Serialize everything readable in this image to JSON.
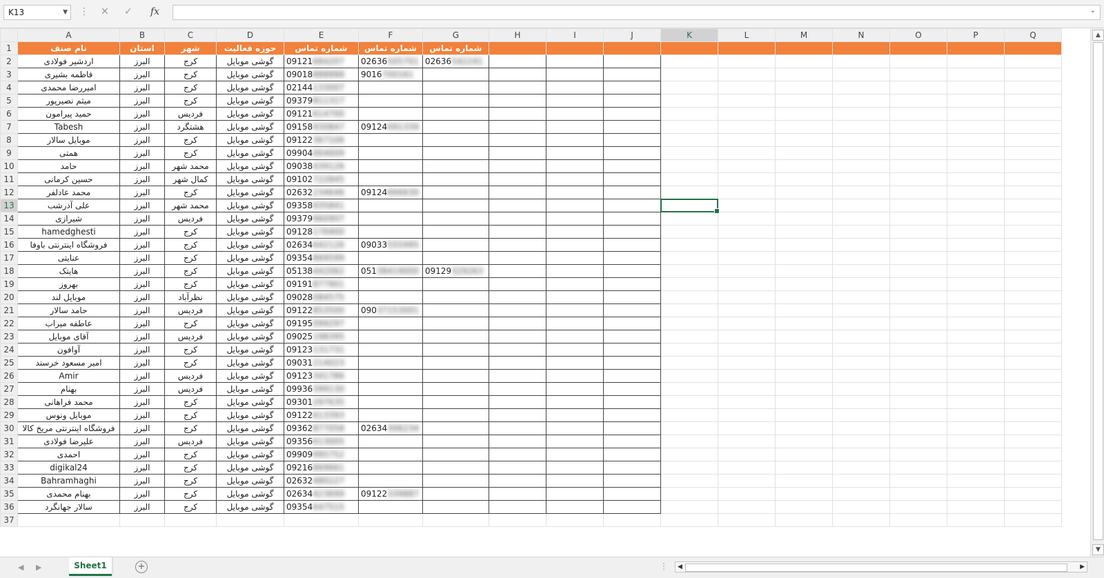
{
  "formula_bar": {
    "name_box": "K13",
    "cancel_icon": "cancel-icon",
    "confirm_icon": "check-icon",
    "fx_label": "fx",
    "formula": ""
  },
  "columns": [
    "A",
    "B",
    "C",
    "D",
    "E",
    "F",
    "G",
    "H",
    "I",
    "J",
    "K",
    "L",
    "M",
    "N",
    "O",
    "P",
    "Q"
  ],
  "selected_cell": {
    "column": "K",
    "row": 13
  },
  "header_row": [
    "نام صنف",
    "استان",
    "شهر",
    "حوزه فعالیت",
    "شماره تماس",
    "شماره تماس",
    "شماره تماس"
  ],
  "rows": [
    {
      "n": "2",
      "name": "اردشیر فولادی",
      "state": "البرز",
      "city": "کرج",
      "field": "گوشی موبایل",
      "p1": "09121",
      "p1h": "684207",
      "p2": "02636",
      "p2h": "505701",
      "p3": "02636",
      "p3h": "542241"
    },
    {
      "n": "3",
      "name": "فاطمه بشیری",
      "state": "البرز",
      "city": "کرج",
      "field": "گوشی موبایل",
      "p1": "09018",
      "p1h": "888888",
      "p2": "9016",
      "p2h": "700161",
      "p3": "",
      "p3h": ""
    },
    {
      "n": "4",
      "name": "امیررضا محمدی",
      "state": "البرز",
      "city": "کرج",
      "field": "گوشی موبایل",
      "p1": "02144",
      "p1h": "133007",
      "p2": "",
      "p2h": "",
      "p3": "",
      "p3h": ""
    },
    {
      "n": "5",
      "name": "میثم نصیرپور",
      "state": "البرز",
      "city": "کرج",
      "field": "گوشی موبایل",
      "p1": "09379",
      "p1h": "811317",
      "p2": "",
      "p2h": "",
      "p3": "",
      "p3h": ""
    },
    {
      "n": "6",
      "name": "حمید پیرامون",
      "state": "البرز",
      "city": "فردیس",
      "field": "گوشی موبایل",
      "p1": "09121",
      "p1h": "614700",
      "p2": "",
      "p2h": "",
      "p3": "",
      "p3h": ""
    },
    {
      "n": "7",
      "name": "Tabesh",
      "state": "البرز",
      "city": "هشتگرد",
      "field": "گوشی موبایل",
      "p1": "09158",
      "p1h": "930847",
      "p2": "09124",
      "p2h": "091339",
      "p3": "",
      "p3h": ""
    },
    {
      "n": "8",
      "name": "موبایل سالار",
      "state": "البرز",
      "city": "کرج",
      "field": "گوشی موبایل",
      "p1": "09122",
      "p1h": "367106",
      "p2": "",
      "p2h": "",
      "p3": "",
      "p3h": ""
    },
    {
      "n": "9",
      "name": "همتی",
      "state": "البرز",
      "city": "کرج",
      "field": "گوشی موبایل",
      "p1": "09904",
      "p1h": "004609",
      "p2": "",
      "p2h": "",
      "p3": "",
      "p3h": ""
    },
    {
      "n": "10",
      "name": "حامد",
      "state": "البرز",
      "city": "محمد شهر",
      "field": "گوشی موبایل",
      "p1": "09038",
      "p1h": "439126",
      "p2": "",
      "p2h": "",
      "p3": "",
      "p3h": ""
    },
    {
      "n": "11",
      "name": "حسین کرمانی",
      "state": "البرز",
      "city": "کمال شهر",
      "field": "گوشی موبایل",
      "p1": "09102",
      "p1h": "722845",
      "p2": "",
      "p2h": "",
      "p3": "",
      "p3h": ""
    },
    {
      "n": "12",
      "name": "محمد عادلفر",
      "state": "البرز",
      "city": "کرج",
      "field": "گوشی موبایل",
      "p1": "02632",
      "p1h": "234646",
      "p2": "09124",
      "p2h": "666630",
      "p3": "",
      "p3h": ""
    },
    {
      "n": "13",
      "name": "علی آذرشب",
      "state": "البرز",
      "city": "محمد شهر",
      "field": "گوشی موبایل",
      "p1": "09358",
      "p1h": "935841",
      "p2": "",
      "p2h": "",
      "p3": "",
      "p3h": ""
    },
    {
      "n": "14",
      "name": "شیرازی",
      "state": "البرز",
      "city": "فردیس",
      "field": "گوشی موبایل",
      "p1": "09379",
      "p1h": "960907",
      "p2": "",
      "p2h": "",
      "p3": "",
      "p3h": ""
    },
    {
      "n": "15",
      "name": "hamedghesti",
      "state": "البرز",
      "city": "کرج",
      "field": "گوشی موبایل",
      "p1": "09128",
      "p1h": "176900",
      "p2": "",
      "p2h": "",
      "p3": "",
      "p3h": ""
    },
    {
      "n": "16",
      "name": "فروشگاه اینترنتی باوفا",
      "state": "البرز",
      "city": "کرج",
      "field": "گوشی موبایل",
      "p1": "02634",
      "p1h": "642126",
      "p2": "09033",
      "p2h": "555995",
      "p3": "",
      "p3h": ""
    },
    {
      "n": "17",
      "name": "عنایتی",
      "state": "البرز",
      "city": "کرج",
      "field": "گوشی موبایل",
      "p1": "09354",
      "p1h": "869599",
      "p2": "",
      "p2h": "",
      "p3": "",
      "p3h": ""
    },
    {
      "n": "18",
      "name": "هایتک",
      "state": "البرز",
      "city": "کرج",
      "field": "گوشی موبایل",
      "p1": "05138",
      "p1h": "442062",
      "p2": "051",
      "p2h": "38419000",
      "p3": "09129",
      "p3h": "329263"
    },
    {
      "n": "19",
      "name": "بهروز",
      "state": "البرز",
      "city": "کرج",
      "field": "گوشی موبایل",
      "p1": "09191",
      "p1h": "877901",
      "p2": "",
      "p2h": "",
      "p3": "",
      "p3h": ""
    },
    {
      "n": "20",
      "name": "موبایل لند",
      "state": "البرز",
      "city": "نظرآباد",
      "field": "گوشی موبایل",
      "p1": "09028",
      "p1h": "084575",
      "p2": "",
      "p2h": "",
      "p3": "",
      "p3h": ""
    },
    {
      "n": "21",
      "name": "حامد سالار",
      "state": "البرز",
      "city": "فردیس",
      "field": "گوشی موبایل",
      "p1": "09122",
      "p1h": "853500",
      "p2": "090",
      "p2h": "37153001",
      "p3": "",
      "p3h": ""
    },
    {
      "n": "22",
      "name": "عاطفه میراب",
      "state": "البرز",
      "city": "کرج",
      "field": "گوشی موبایل",
      "p1": "09195",
      "p1h": "099297",
      "p2": "",
      "p2h": "",
      "p3": "",
      "p3h": ""
    },
    {
      "n": "23",
      "name": "آقای موبایل",
      "state": "البرز",
      "city": "فردیس",
      "field": "گوشی موبایل",
      "p1": "09025",
      "p1h": "198395",
      "p2": "",
      "p2h": "",
      "p3": "",
      "p3h": ""
    },
    {
      "n": "24",
      "name": "آوافون",
      "state": "البرز",
      "city": "کرج",
      "field": "گوشی موبایل",
      "p1": "09123",
      "p1h": "131731",
      "p2": "",
      "p2h": "",
      "p3": "",
      "p3h": ""
    },
    {
      "n": "25",
      "name": "امیر مسعود خرسند",
      "state": "البرز",
      "city": "کرج",
      "field": "گوشی موبایل",
      "p1": "09031",
      "p1h": "214023",
      "p2": "",
      "p2h": "",
      "p3": "",
      "p3h": ""
    },
    {
      "n": "26",
      "name": "Amir",
      "state": "البرز",
      "city": "فردیس",
      "field": "گوشی موبایل",
      "p1": "09123",
      "p1h": "341786",
      "p2": "",
      "p2h": "",
      "p3": "",
      "p3h": ""
    },
    {
      "n": "27",
      "name": "بهنام",
      "state": "البرز",
      "city": "فردیس",
      "field": "گوشی موبایل",
      "p1": "09936",
      "p1h": "399130",
      "p2": "",
      "p2h": "",
      "p3": "",
      "p3h": ""
    },
    {
      "n": "28",
      "name": "محمد فراهانی",
      "state": "البرز",
      "city": "کرج",
      "field": "گوشی موبایل",
      "p1": "09301",
      "p1h": "297635",
      "p2": "",
      "p2h": "",
      "p3": "",
      "p3h": ""
    },
    {
      "n": "29",
      "name": "موبایل ونوس",
      "state": "البرز",
      "city": "کرج",
      "field": "گوشی موبایل",
      "p1": "09122",
      "p1h": "613393",
      "p2": "",
      "p2h": "",
      "p3": "",
      "p3h": ""
    },
    {
      "n": "30",
      "name": "فروشگاه اینترنتی مریخ کالا",
      "state": "البرز",
      "city": "کرج",
      "field": "گوشی موبایل",
      "p1": "09362",
      "p1h": "877058",
      "p2": "02634",
      "p2h": "306234",
      "p3": "",
      "p3h": ""
    },
    {
      "n": "31",
      "name": "علیرضا فولادی",
      "state": "البرز",
      "city": "فردیس",
      "field": "گوشی موبایل",
      "p1": "09356",
      "p1h": "613005",
      "p2": "",
      "p2h": "",
      "p3": "",
      "p3h": ""
    },
    {
      "n": "32",
      "name": "احمدی",
      "state": "البرز",
      "city": "کرج",
      "field": "گوشی موبایل",
      "p1": "09909",
      "p1h": "995752",
      "p2": "",
      "p2h": "",
      "p3": "",
      "p3h": ""
    },
    {
      "n": "33",
      "name": "digikal24",
      "state": "البرز",
      "city": "کرج",
      "field": "گوشی موبایل",
      "p1": "09216",
      "p1h": "869661",
      "p2": "",
      "p2h": "",
      "p3": "",
      "p3h": ""
    },
    {
      "n": "34",
      "name": "Bahramhaghi",
      "state": "البرز",
      "city": "کرج",
      "field": "گوشی موبایل",
      "p1": "02632",
      "p1h": "480227",
      "p2": "",
      "p2h": "",
      "p3": "",
      "p3h": ""
    },
    {
      "n": "35",
      "name": "بهنام محمدی",
      "state": "البرز",
      "city": "کرج",
      "field": "گوشی موبایل",
      "p1": "02634",
      "p1h": "423699",
      "p2": "09122",
      "p2h": "339887",
      "p3": "",
      "p3h": ""
    },
    {
      "n": "36",
      "name": "سالار جهانگرد",
      "state": "البرز",
      "city": "کرج",
      "field": "گوشی موبایل",
      "p1": "09354",
      "p1h": "647515",
      "p2": "",
      "p2h": "",
      "p3": "",
      "p3h": ""
    }
  ],
  "sheet_tabs": [
    {
      "label": "Sheet1",
      "active": true
    }
  ],
  "colors": {
    "header_fill": "#f2813b",
    "header_text": "#ffffff",
    "selection": "#217346"
  }
}
